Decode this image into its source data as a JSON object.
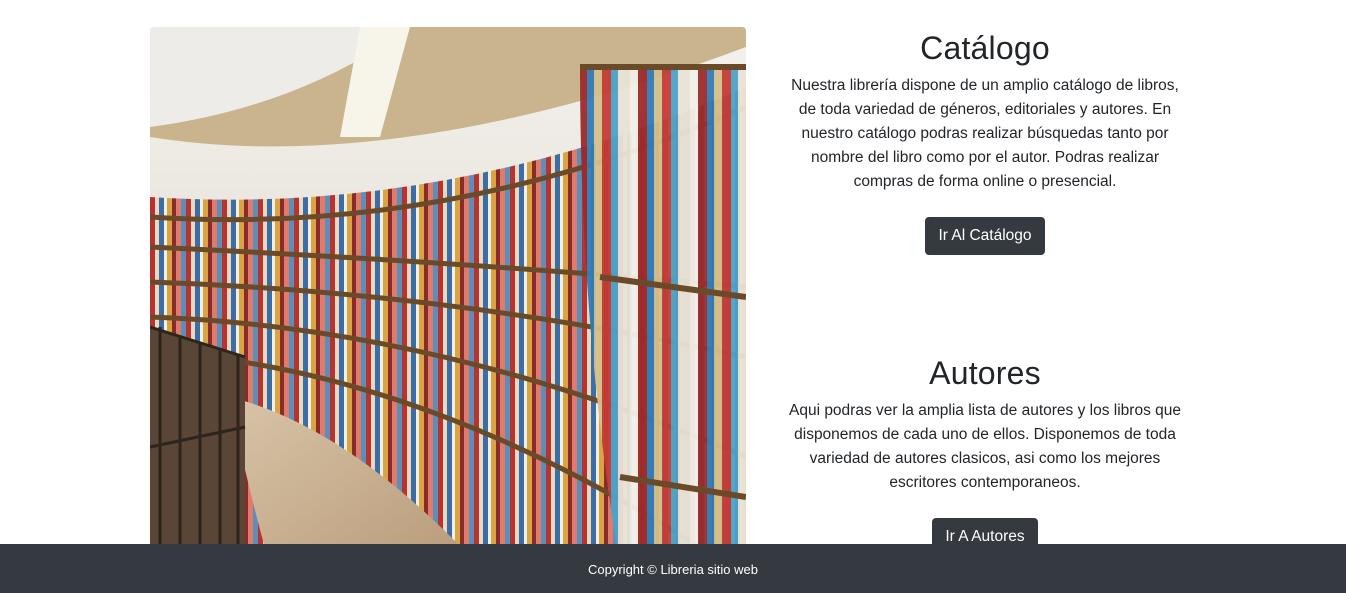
{
  "hero": {
    "image_label": "library-bookshelves-photo"
  },
  "catalogo": {
    "title": "Catálogo",
    "description": "Nuestra librería dispone de un amplio catálogo de libros, de toda variedad de géneros, editoriales y autores. En nuestro catálogo podras realizar búsquedas tanto por nombre del libro como por el autor. Podras realizar compras de forma online o presencial.",
    "button_label": "Ir Al Catálogo"
  },
  "autores": {
    "title": "Autores",
    "description": "Aqui podras ver la amplia lista de autores y los libros que disponemos de cada uno de ellos. Disponemos de toda variedad de autores clasicos, asi como los mejores escritores contemporaneos.",
    "button_label": "Ir A Autores"
  },
  "footer": {
    "copyright": "Copyright © Libreria sitio web"
  },
  "colors": {
    "dark": "#343a40",
    "text": "#212529",
    "background": "#ffffff"
  }
}
